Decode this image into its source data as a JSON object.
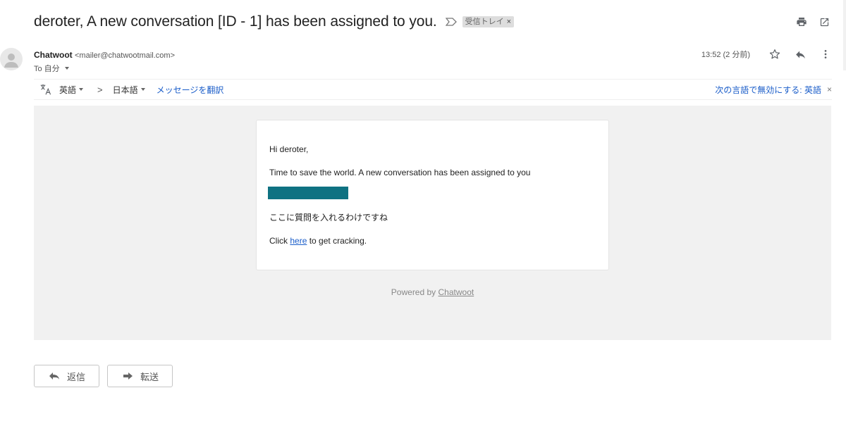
{
  "subject": "deroter, A new conversation [ID - 1] has been assigned to you.",
  "label_chip": {
    "text": "受信トレイ",
    "close": "×"
  },
  "sender": {
    "name": "Chatwoot",
    "email": "<mailer@chatwootmail.com>",
    "to": "To 自分"
  },
  "timestamp": "13:52 (2 分前)",
  "translate_bar": {
    "from_lang": "英語",
    "separator": ">",
    "to_lang": "日本語",
    "translate_link": "メッセージを翻訳",
    "disable_link": "次の言語で無効にする: 英語",
    "close": "×"
  },
  "message": {
    "greeting": "Hi deroter,",
    "line1": "Time to save the world. A new conversation has been assigned to you",
    "question": "ここに質問を入れるわけですね",
    "click_pre": "Click ",
    "click_link": "here",
    "click_post": " to get cracking."
  },
  "footer": {
    "powered_pre": "Powered by ",
    "powered_link": "Chatwoot"
  },
  "buttons": {
    "reply": "返信",
    "forward": "転送"
  },
  "colors": {
    "link": "#1a5dc9",
    "redaction": "#0f7282",
    "body_bg": "#f1f1f1"
  },
  "icons": [
    "important-marker-icon",
    "print-icon",
    "open-new-window-icon",
    "avatar-person-icon",
    "star-icon",
    "reply-icon",
    "more-vert-icon",
    "translate-icon",
    "reply-arrow-icon",
    "forward-arrow-icon"
  ]
}
